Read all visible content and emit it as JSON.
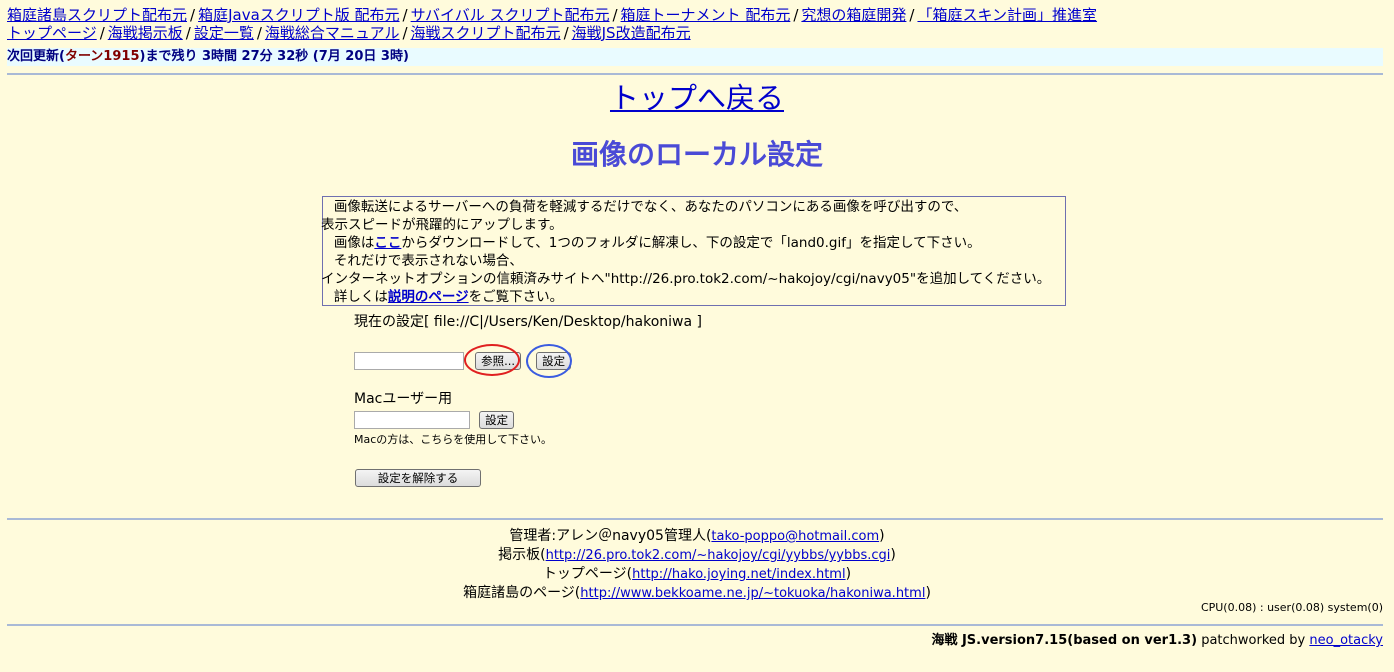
{
  "nav": {
    "row1": [
      "箱庭諸島スクリプト配布元",
      "箱庭Javaスクリプト版 配布元",
      "サバイバル スクリプト配布元",
      "箱庭トーナメント 配布元",
      "究想の箱庭開発",
      "「箱庭スキン計画」推進室"
    ],
    "row2": [
      "トップページ",
      "海戦掲示板",
      "設定一覧",
      "海戦総合マニュアル",
      "海戦スクリプト配布元",
      "海戦JS改造配布元"
    ]
  },
  "turnbar": {
    "prefix": "次回更新(",
    "turn_label": "ターン1915",
    "suffix": ")まで残り 3時間 27分 32秒 (7月 20日 3時)"
  },
  "top_link": "トップへ戻る",
  "page_title": "画像のローカル設定",
  "info": {
    "line1": "画像転送によるサーバーへの負荷を軽減するだけでなく、あなたのパソコンにある画像を呼び出すので、",
    "line2": "表示スピードが飛躍的にアップします。",
    "line3_a": "画像は",
    "line3_link": "ここ",
    "line3_b": "からダウンロードして、1つのフォルダに解凍し、下の設定で「land0.gif」を指定して下さい。",
    "line4": "それだけで表示されない場合、",
    "line5": "インターネットオプションの信頼済みサイトへ\"http://26.pro.tok2.com/~hakojoy/cgi/navy05\"を追加してください。",
    "line6_a": "詳しくは",
    "line6_link": "説明のページ",
    "line6_b": "をご覧下さい。"
  },
  "current_setting": "現在の設定[ file://C|/Users/Ken/Desktop/hakoniwa ]",
  "form": {
    "browse_label": "参照...",
    "set_label": "設定",
    "mac_label": "Macユーザー用",
    "mac_set_label": "設定",
    "mac_note": "Macの方は、こちらを使用して下さい。",
    "reset_label": "設定を解除する"
  },
  "footer": {
    "admin_prefix": "管理者:アレン＠navy05管理人(",
    "admin_email": "tako-poppo@hotmail.com",
    "admin_suffix": ")",
    "bbs_prefix": "掲示板(",
    "bbs_url": "http://26.pro.tok2.com/~hakojoy/cgi/yybbs/yybbs.cgi",
    "bbs_suffix": ")",
    "top_prefix": "トップページ(",
    "top_url": "http://hako.joying.net/index.html",
    "top_suffix": ")",
    "hako_prefix": "箱庭諸島のページ(",
    "hako_url": "http://www.bekkoame.ne.jp/~tokuoka/hakoniwa.html",
    "hako_suffix": ")"
  },
  "cpu": "CPU(0.08) : user(0.08) system(0)",
  "version": {
    "main": "海戦 JS.version7.15(based on ver1.3)",
    "patch_prefix": "patchworked by",
    "patch_link": "neo_otacky"
  },
  "colors": {
    "background": "#fffbdc",
    "link": "#0000cc",
    "title": "#4a4ad6",
    "annotation_red": "#e02020",
    "annotation_blue": "#3b5ce0"
  }
}
